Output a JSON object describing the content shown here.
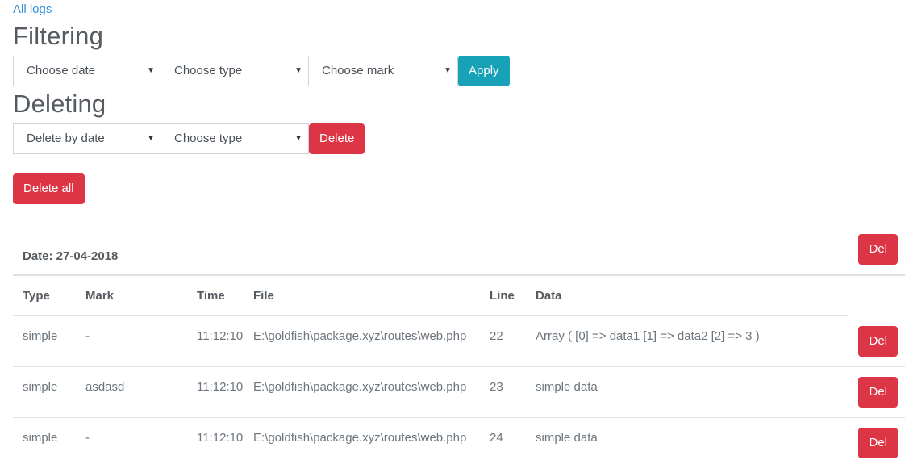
{
  "nav": {
    "all_logs": "All logs"
  },
  "filtering": {
    "heading": "Filtering",
    "date_select": "Choose date",
    "type_select": "Choose type",
    "mark_select": "Choose mark",
    "apply_label": "Apply"
  },
  "deleting": {
    "heading": "Deleting",
    "date_select": "Delete by date",
    "type_select": "Choose type",
    "delete_label": "Delete"
  },
  "delete_all_label": "Delete all",
  "log_group": {
    "date_label": "Date: 27-04-2018",
    "del_label": "Del",
    "columns": [
      "Type",
      "Mark",
      "Time",
      "File",
      "Line",
      "Data"
    ],
    "rows": [
      {
        "type": "simple",
        "mark": "-",
        "time": "11:12:10",
        "file": "E:\\goldfish\\package.xyz\\routes\\web.php",
        "line": "22",
        "data": "Array ( [0] => data1 [1] => data2 [2] => 3 )",
        "del": "Del"
      },
      {
        "type": "simple",
        "mark": "asdasd",
        "time": "11:12:10",
        "file": "E:\\goldfish\\package.xyz\\routes\\web.php",
        "line": "23",
        "data": "simple data",
        "del": "Del"
      },
      {
        "type": "simple",
        "mark": "-",
        "time": "11:12:10",
        "file": "E:\\goldfish\\package.xyz\\routes\\web.php",
        "line": "24",
        "data": "simple data",
        "del": "Del"
      }
    ]
  },
  "colors": {
    "link": "#3490dc",
    "info": "#17a2b8",
    "danger": "#dc3545",
    "border": "#dee2e6"
  }
}
